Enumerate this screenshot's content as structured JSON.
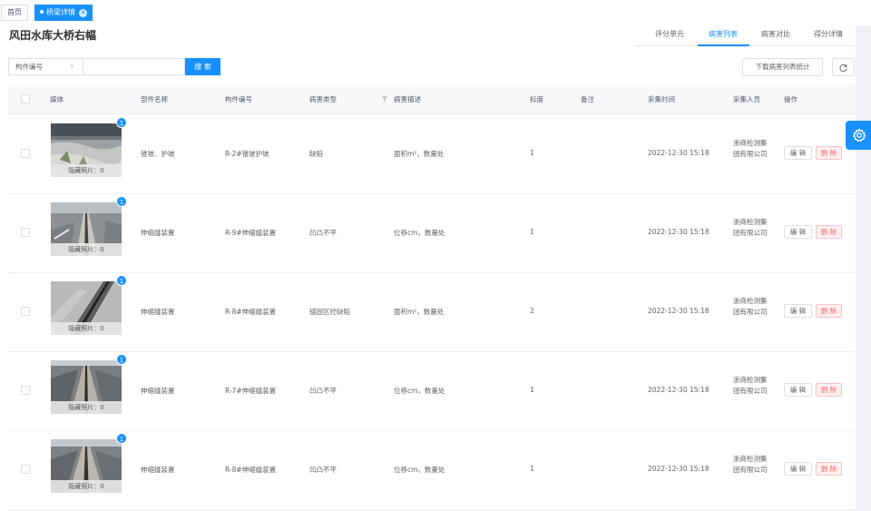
{
  "tags": {
    "home_label": "首页",
    "active_label": "桥梁详情"
  },
  "page": {
    "title": "风田水库大桥右幅"
  },
  "tabs": [
    {
      "label": "评分单元",
      "active": false
    },
    {
      "label": "病害列表",
      "active": true
    },
    {
      "label": "病害对比",
      "active": false
    },
    {
      "label": "得分详情",
      "active": false
    }
  ],
  "toolbar": {
    "select_value": "构件编号",
    "search_input_value": "",
    "search_label": "搜 索",
    "download_label": "下载病害列表统计"
  },
  "columns": {
    "media": "媒体",
    "part_name": "部件名称",
    "component_no": "构件编号",
    "disease_type": "病害类型",
    "description": "病害描述",
    "scale": "标度",
    "remark": "备注",
    "time": "采集时间",
    "collector": "采集人员",
    "action": "操作"
  },
  "media_caption": "隐藏照片：0",
  "edit_label": "编 辑",
  "delete_label": "删 除",
  "accent_color": "#1890ff",
  "danger_color": "#f56c6c",
  "rows": [
    {
      "badge": "1",
      "part": "锥坡、护坡",
      "component": "R-2#锥坡护坡",
      "type": "缺陷",
      "desc": "面积m²，数量处",
      "scale": "1",
      "remark": "",
      "time": "2022-12-30 15:18",
      "collector": "浙商检测集团有限公司",
      "photo": "slope"
    },
    {
      "badge": "1",
      "part": "伸缩缝装置",
      "component": "R-9#伸缩缝装置",
      "type": "凹凸不平",
      "desc": "位移cm，数量处",
      "scale": "1",
      "remark": "",
      "time": "2022-12-30 15:18",
      "collector": "浙商检测集团有限公司",
      "photo": "joint-road"
    },
    {
      "badge": "1",
      "part": "伸缩缝装置",
      "component": "R-8#伸缩缝装置",
      "type": "锚固区砼缺陷",
      "desc": "面积m²，数量处",
      "scale": "2",
      "remark": "",
      "time": "2022-12-30 15:18",
      "collector": "浙商检测集团有限公司",
      "photo": "joint-diag"
    },
    {
      "badge": "1",
      "part": "伸缩缝装置",
      "component": "R-7#伸缩缝装置",
      "type": "凹凸不平",
      "desc": "位移cm，数量处",
      "scale": "1",
      "remark": "",
      "time": "2022-12-30 15:18",
      "collector": "浙商检测集团有限公司",
      "photo": "joint-center"
    },
    {
      "badge": "1",
      "part": "伸缩缝装置",
      "component": "R-8#伸缩缝装置",
      "type": "凹凸不平",
      "desc": "位移cm，数量处",
      "scale": "1",
      "remark": "",
      "time": "2022-12-30 15:18",
      "collector": "浙商检测集团有限公司",
      "photo": "joint-center2"
    }
  ]
}
